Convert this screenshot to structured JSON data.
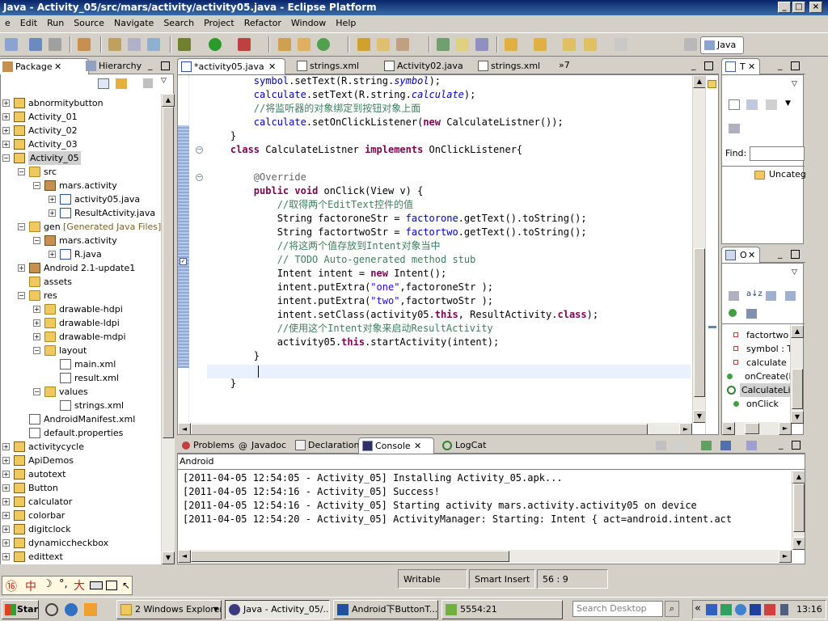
{
  "window": {
    "title": "Java - Activity_05/src/mars/activity/activity05.java - Eclipse Platform"
  },
  "menu": [
    "e",
    "Edit",
    "Run",
    "Source",
    "Navigate",
    "Search",
    "Project",
    "Refactor",
    "Window",
    "Help"
  ],
  "perspective": {
    "label": "Java"
  },
  "left_panel": {
    "tabs": [
      {
        "label": "Package",
        "active": true
      },
      {
        "label": "Hierarchy",
        "active": false
      }
    ],
    "tree": [
      {
        "label": "abnormitybutton",
        "depth": 0,
        "type": "proj",
        "toggle": "+"
      },
      {
        "label": "Activity_01",
        "depth": 0,
        "type": "proj",
        "toggle": "+"
      },
      {
        "label": "Activity_02",
        "depth": 0,
        "type": "proj",
        "toggle": "+"
      },
      {
        "label": "Activity_03",
        "depth": 0,
        "type": "proj",
        "toggle": "+"
      },
      {
        "label": "Activity_05",
        "depth": 0,
        "type": "proj",
        "toggle": "-",
        "selected": true
      },
      {
        "label": "src",
        "depth": 1,
        "type": "folder",
        "toggle": "-"
      },
      {
        "label": "mars.activity",
        "depth": 2,
        "type": "pkg",
        "toggle": "-"
      },
      {
        "label": "activity05.java",
        "depth": 3,
        "type": "java",
        "toggle": "+"
      },
      {
        "label": "ResultActivity.java",
        "depth": 3,
        "type": "java",
        "toggle": "+"
      },
      {
        "label": "gen",
        "depth": 1,
        "type": "folder",
        "toggle": "-",
        "suffix": "[Generated Java Files]"
      },
      {
        "label": "mars.activity",
        "depth": 2,
        "type": "pkg",
        "toggle": "-"
      },
      {
        "label": "R.java",
        "depth": 3,
        "type": "java",
        "toggle": "+"
      },
      {
        "label": "Android 2.1-update1",
        "depth": 1,
        "type": "lib",
        "toggle": "+"
      },
      {
        "label": "assets",
        "depth": 1,
        "type": "folder",
        "toggle": ""
      },
      {
        "label": "res",
        "depth": 1,
        "type": "folder",
        "toggle": "-"
      },
      {
        "label": "drawable-hdpi",
        "depth": 2,
        "type": "folder",
        "toggle": "+"
      },
      {
        "label": "drawable-ldpi",
        "depth": 2,
        "type": "folder",
        "toggle": "+"
      },
      {
        "label": "drawable-mdpi",
        "depth": 2,
        "type": "folder",
        "toggle": "+"
      },
      {
        "label": "layout",
        "depth": 2,
        "type": "folder",
        "toggle": "-"
      },
      {
        "label": "main.xml",
        "depth": 3,
        "type": "xml",
        "toggle": ""
      },
      {
        "label": "result.xml",
        "depth": 3,
        "type": "xml",
        "toggle": ""
      },
      {
        "label": "values",
        "depth": 2,
        "type": "folder",
        "toggle": "-"
      },
      {
        "label": "strings.xml",
        "depth": 3,
        "type": "xml",
        "toggle": ""
      },
      {
        "label": "AndroidManifest.xml",
        "depth": 1,
        "type": "xml",
        "toggle": ""
      },
      {
        "label": "default.properties",
        "depth": 1,
        "type": "xml",
        "toggle": ""
      },
      {
        "label": "activitycycle",
        "depth": 0,
        "type": "proj",
        "toggle": "+"
      },
      {
        "label": "ApiDemos",
        "depth": 0,
        "type": "proj",
        "toggle": "+"
      },
      {
        "label": "autotext",
        "depth": 0,
        "type": "proj",
        "toggle": "+"
      },
      {
        "label": "Button",
        "depth": 0,
        "type": "proj",
        "toggle": "+"
      },
      {
        "label": "calculator",
        "depth": 0,
        "type": "proj",
        "toggle": "+"
      },
      {
        "label": "colorbar",
        "depth": 0,
        "type": "proj",
        "toggle": "+"
      },
      {
        "label": "digitclock",
        "depth": 0,
        "type": "proj",
        "toggle": "+"
      },
      {
        "label": "dynamiccheckbox",
        "depth": 0,
        "type": "proj",
        "toggle": "+"
      },
      {
        "label": "edittext",
        "depth": 0,
        "type": "proj",
        "toggle": "+"
      }
    ]
  },
  "editor": {
    "tabs": [
      {
        "label": "*activity05.java",
        "active": true
      },
      {
        "label": "strings.xml",
        "active": false
      },
      {
        "label": "Activity02.java",
        "active": false
      },
      {
        "label": "strings.xml",
        "active": false
      }
    ],
    "overflow": "»7",
    "lines": [
      [
        [
          "",
          "        "
        ],
        [
          "fld",
          "symbol"
        ],
        [
          "",
          ".setText(R.string."
        ],
        [
          "fldi",
          "symbol"
        ],
        [
          "",
          ");"
        ]
      ],
      [
        [
          "",
          "        "
        ],
        [
          "fld",
          "calculate"
        ],
        [
          "",
          ".setText(R.string."
        ],
        [
          "fldi",
          "calculate"
        ],
        [
          "",
          ");"
        ]
      ],
      [
        [
          "",
          "        "
        ],
        [
          "cmt",
          "//将监听器的对象绑定到按钮对象上面"
        ]
      ],
      [
        [
          "",
          "        "
        ],
        [
          "fld",
          "calculate"
        ],
        [
          "",
          ".setOnClickListener("
        ],
        [
          "kw",
          "new"
        ],
        [
          "",
          " CalculateListner());"
        ]
      ],
      [
        [
          "",
          "    }"
        ]
      ],
      [
        [
          "",
          "    "
        ],
        [
          "kw",
          "class"
        ],
        [
          "",
          " CalculateListner "
        ],
        [
          "kw",
          "implements"
        ],
        [
          "",
          " OnClickListener{"
        ]
      ],
      [
        [
          "",
          ""
        ]
      ],
      [
        [
          "",
          "        "
        ],
        [
          "ann",
          "@Override"
        ]
      ],
      [
        [
          "",
          "        "
        ],
        [
          "kw",
          "public"
        ],
        [
          "",
          " "
        ],
        [
          "kw",
          "void"
        ],
        [
          "",
          " onClick(View v) {"
        ]
      ],
      [
        [
          "",
          "            "
        ],
        [
          "cmt",
          "//取得两个EditText控件的值"
        ]
      ],
      [
        [
          "",
          "            String factoroneStr = "
        ],
        [
          "fld",
          "factorone"
        ],
        [
          "",
          ".getText().toString();"
        ]
      ],
      [
        [
          "",
          "            String factortwoStr = "
        ],
        [
          "fld",
          "factortwo"
        ],
        [
          "",
          ".getText().toString();"
        ]
      ],
      [
        [
          "",
          "            "
        ],
        [
          "cmt",
          "//将这两个值存放到Intent对象当中"
        ]
      ],
      [
        [
          "",
          "            "
        ],
        [
          "cmt",
          "// TODO Auto-generated method stub"
        ]
      ],
      [
        [
          "",
          "            Intent intent = "
        ],
        [
          "kw",
          "new"
        ],
        [
          "",
          " Intent();"
        ]
      ],
      [
        [
          "",
          "            intent.putExtra("
        ],
        [
          "str",
          "\"one\""
        ],
        [
          "",
          ",factoroneStr );"
        ]
      ],
      [
        [
          "",
          "            intent.putExtra("
        ],
        [
          "str",
          "\"two\""
        ],
        [
          "",
          ",factortwoStr );"
        ]
      ],
      [
        [
          "",
          "            intent.setClass(activity05."
        ],
        [
          "kw",
          "this"
        ],
        [
          "",
          ", ResultActivity."
        ],
        [
          "kw",
          "class"
        ],
        [
          "",
          ");"
        ]
      ],
      [
        [
          "",
          "            "
        ],
        [
          "cmt",
          "//使用这个Intent对象来启动ResultActivity"
        ]
      ],
      [
        [
          "",
          "            activity05."
        ],
        [
          "kw",
          "this"
        ],
        [
          "",
          ".startActivity(intent);"
        ]
      ],
      [
        [
          "",
          "        }"
        ]
      ],
      [
        [
          "",
          "        "
        ]
      ],
      [
        [
          "",
          "    }"
        ]
      ]
    ]
  },
  "task_panel": {
    "tab": "T",
    "find_label": "Find:",
    "category": "Uncateg"
  },
  "outline_panel": {
    "tab": "O",
    "items": [
      {
        "label": "factortwo : ",
        "depth": 1,
        "kind": "field"
      },
      {
        "label": "symbol : Te",
        "depth": 1,
        "kind": "field"
      },
      {
        "label": "calculate : E",
        "depth": 1,
        "kind": "field"
      },
      {
        "label": "onCreate(Bu",
        "depth": 0,
        "kind": "method"
      },
      {
        "label": "CalculateLis",
        "depth": 0,
        "kind": "class",
        "selected": true
      },
      {
        "label": "onClick",
        "depth": 1,
        "kind": "method"
      }
    ]
  },
  "bottom_panel": {
    "tabs": [
      {
        "label": "Problems",
        "active": false
      },
      {
        "label": "Javadoc",
        "active": false
      },
      {
        "label": "Declaration",
        "active": false
      },
      {
        "label": "Console",
        "active": true
      },
      {
        "label": "LogCat",
        "active": false
      }
    ],
    "console_title": "Android",
    "lines": [
      "[2011-04-05 12:54:05 - Activity_05] Installing Activity_05.apk...",
      "[2011-04-05 12:54:16 - Activity_05] Success!",
      "[2011-04-05 12:54:16 - Activity_05] Starting activity mars.activity.activity05 on device",
      "[2011-04-05 12:54:20 - Activity_05] ActivityManager: Starting: Intent { act=android.intent.act"
    ]
  },
  "status": {
    "ime": "中",
    "writable": "Writable",
    "insert_mode": "Smart Insert",
    "position": "56 : 9"
  },
  "taskbar": {
    "start": "Start",
    "tasks": [
      {
        "label": "2 Windows Explorer",
        "active": false
      },
      {
        "label": "Java - Activity_05/...",
        "active": true
      },
      {
        "label": "Android下ButtonT...",
        "active": false
      },
      {
        "label": "5554:21",
        "active": false
      }
    ],
    "search_placeholder": "Search Desktop",
    "clock": "13:16"
  },
  "colors": {
    "title_bar": "#0a246a",
    "keyword": "#7f0055",
    "field": "#0000c0",
    "comment": "#3f7f5f",
    "string": "#2a00ff",
    "current_line": "#e8f2fe"
  }
}
